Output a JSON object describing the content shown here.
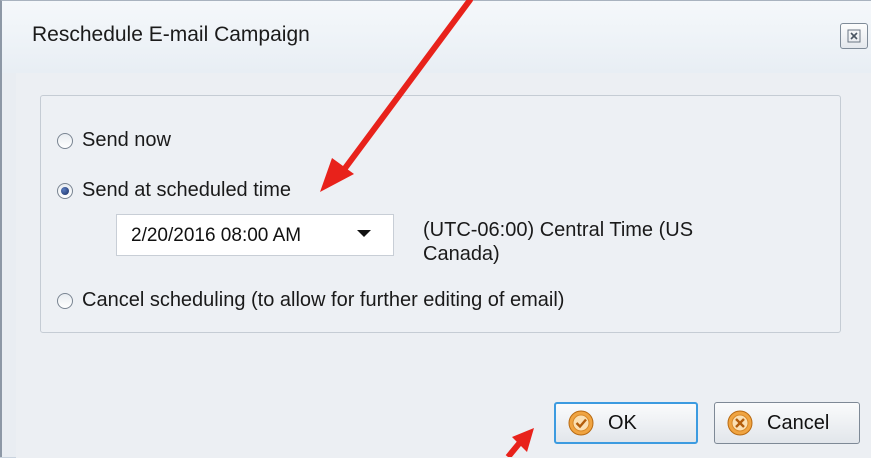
{
  "dialog": {
    "title": "Reschedule E-mail Campaign",
    "close_icon": "close-icon"
  },
  "options": {
    "send_now": {
      "label": "Send now",
      "checked": false
    },
    "send_scheduled": {
      "label": "Send at scheduled time",
      "checked": true
    },
    "cancel_scheduling": {
      "label": "Cancel scheduling (to allow for further editing of email)",
      "checked": false
    }
  },
  "schedule": {
    "datetime_value": "2/20/2016 08:00 AM",
    "timezone_line1": "(UTC-06:00) Central Time (US",
    "timezone_line2": "Canada)"
  },
  "buttons": {
    "ok_label": "OK",
    "cancel_label": "Cancel"
  },
  "annotations": {
    "arrow_color": "#e8221b"
  }
}
